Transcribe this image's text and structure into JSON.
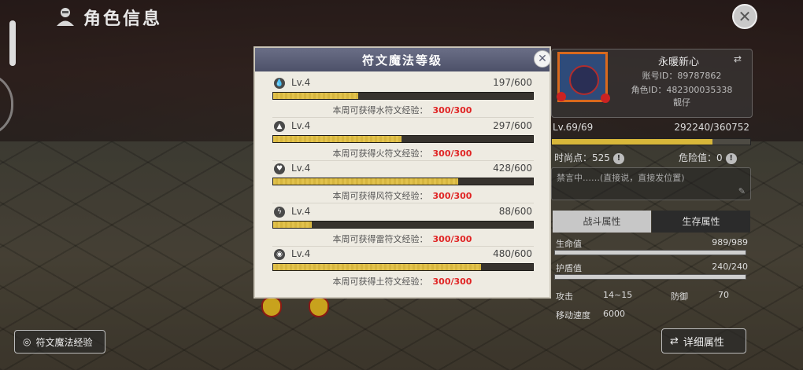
{
  "header": {
    "title": "角色信息"
  },
  "profile": {
    "name": "永暖新心",
    "account_id": "账号ID：89787862",
    "role_id": "角色ID：482300035338",
    "tag": "靓仔",
    "level_text": "Lv.69/69",
    "exp_text": "292240/360752",
    "exp_fraction": 0.81,
    "fashion_label": "时尚点：525",
    "danger_label": "危险值：0",
    "signature_placeholder": "禁言中……(直接说，直接发位置)"
  },
  "tabs": {
    "combat": "战斗属性",
    "survival": "生存属性"
  },
  "attributes": {
    "hp_label": "生命值",
    "hp_value": "989/989",
    "hp_fraction": 1.0,
    "shield_label": "护盾值",
    "shield_value": "240/240",
    "shield_fraction": 1.0,
    "attack_label": "攻击",
    "attack_value": "14~15",
    "defense_label": "防御",
    "defense_value": "70",
    "speed_label": "移动速度",
    "speed_value": "6000"
  },
  "buttons": {
    "rune_exp": "符文魔法经验",
    "detail_attr": "详细属性"
  },
  "modal": {
    "title": "符文魔法等级",
    "runes": [
      {
        "icon": "water-icon",
        "level": "Lv.4",
        "progress": "197/600",
        "fraction": 0.328,
        "weekly": "本周可获得水符文经验：",
        "cap": "300/300"
      },
      {
        "icon": "fire-icon",
        "level": "Lv.4",
        "progress": "297/600",
        "fraction": 0.495,
        "weekly": "本周可获得火符文经验：",
        "cap": "300/300"
      },
      {
        "icon": "wind-icon",
        "level": "Lv.4",
        "progress": "428/600",
        "fraction": 0.713,
        "weekly": "本周可获得风符文经验：",
        "cap": "300/300"
      },
      {
        "icon": "thunder-icon",
        "level": "Lv.4",
        "progress": "88/600",
        "fraction": 0.147,
        "weekly": "本周可获得雷符文经验：",
        "cap": "300/300"
      },
      {
        "icon": "earth-icon",
        "level": "Lv.4",
        "progress": "480/600",
        "fraction": 0.8,
        "weekly": "本周可获得土符文经验：",
        "cap": "300/300"
      }
    ]
  }
}
